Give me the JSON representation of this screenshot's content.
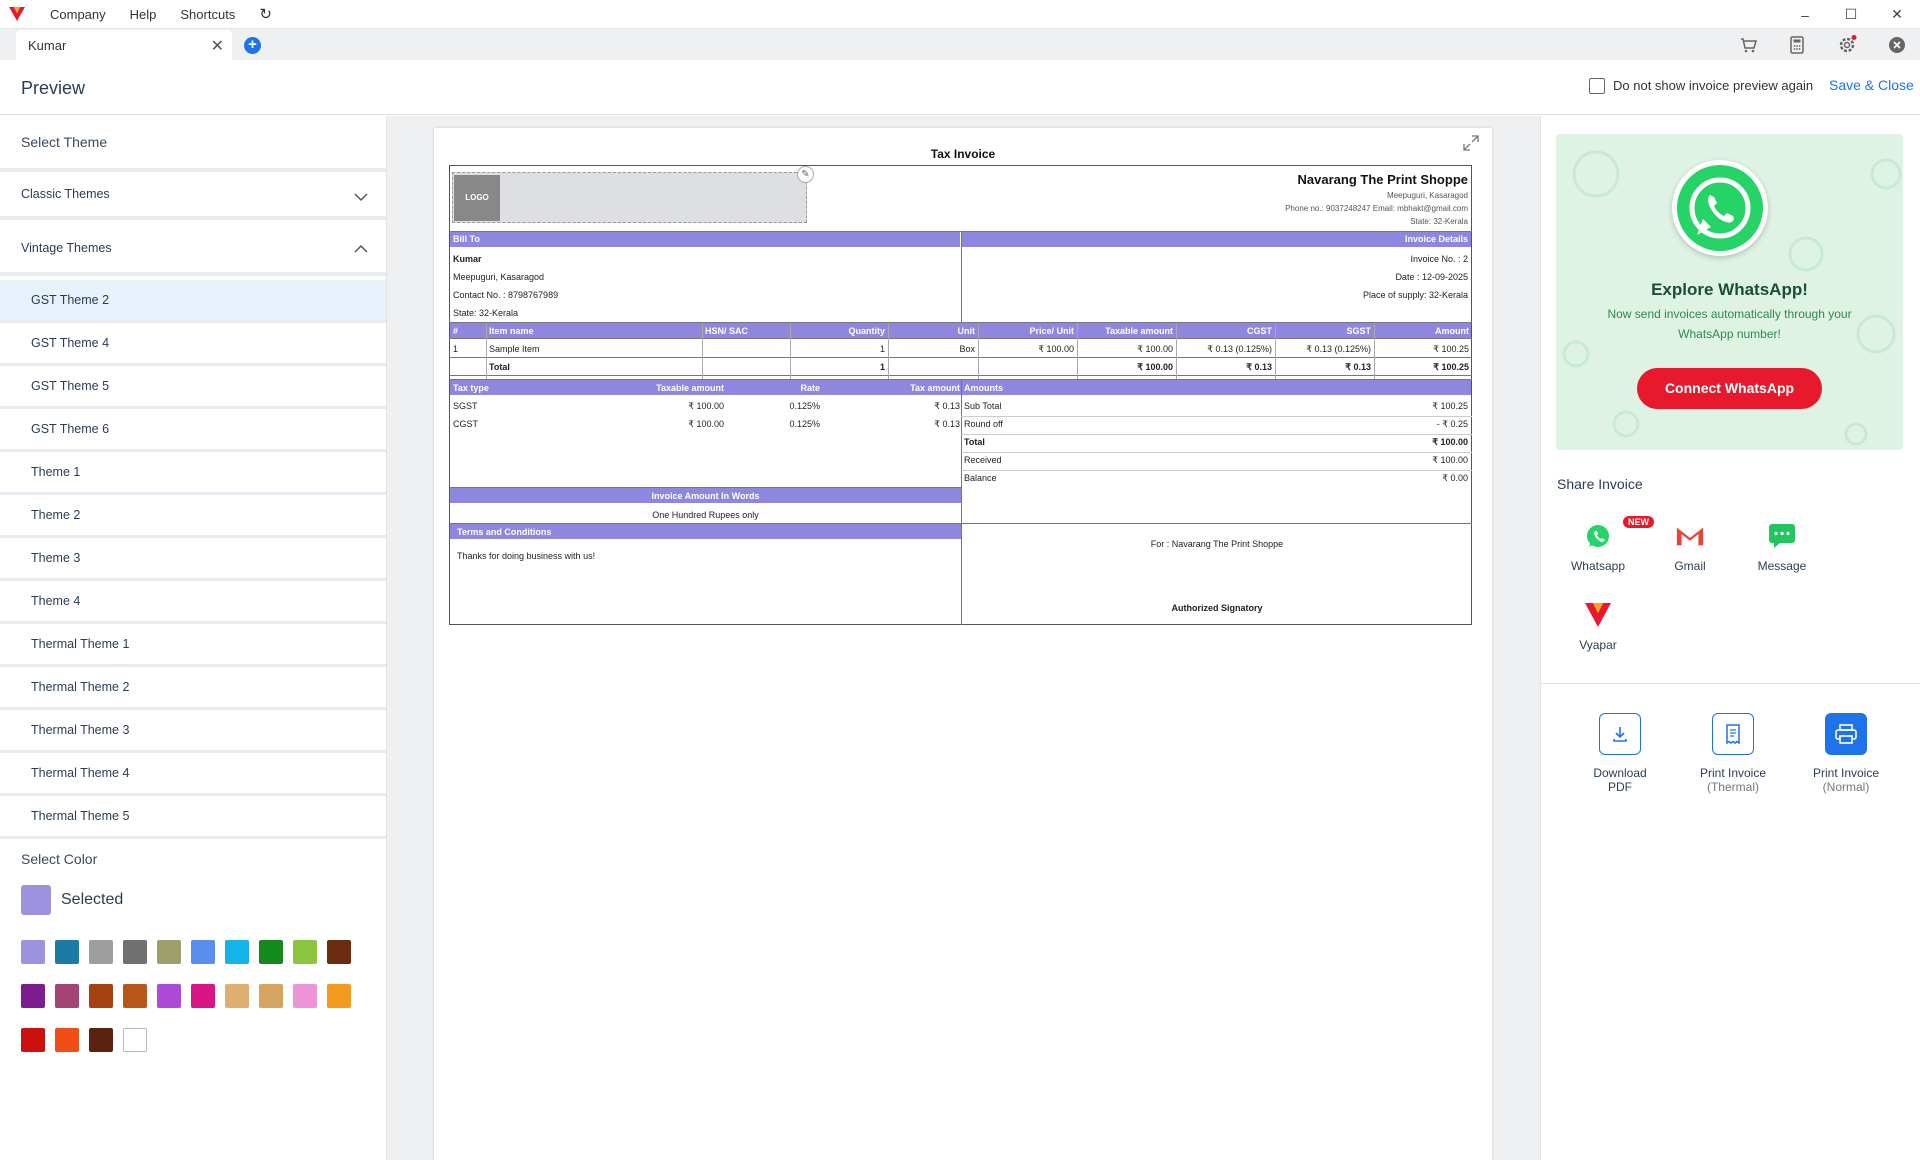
{
  "menubar": {
    "items": [
      "Company",
      "Help",
      "Shortcuts"
    ]
  },
  "tabs": [
    {
      "label": "Kumar"
    }
  ],
  "header": {
    "title": "Preview",
    "checkbox_label": "Do not show invoice preview again",
    "save_close": "Save & Close"
  },
  "left": {
    "select_theme": "Select Theme",
    "classic_themes": "Classic Themes",
    "vintage_themes": "Vintage Themes",
    "themes": [
      "GST Theme 2",
      "GST Theme 4",
      "GST Theme 5",
      "GST Theme 6",
      "Theme 1",
      "Theme 2",
      "Theme 3",
      "Theme 4",
      "Thermal Theme 1",
      "Thermal Theme 2",
      "Thermal Theme 3",
      "Thermal Theme 4",
      "Thermal Theme 5"
    ],
    "selected_theme_index": 0,
    "select_color": "Select Color",
    "selected_label": "Selected",
    "selected_color": "#9b93e0",
    "colors": [
      "#9b93e0",
      "#1b7aa6",
      "#9e9e9e",
      "#707070",
      "#9ea06c",
      "#5b8ded",
      "#16b3ea",
      "#148a1d",
      "#8cc63f",
      "#6b2b0e",
      "#7d1c8f",
      "#a34371",
      "#a5400f",
      "#b85719",
      "#ae49d9",
      "#d91484",
      "#e0ae6e",
      "#d6a45e",
      "#ef94d9",
      "#f39a1e",
      "#cc1010",
      "#ef4e17",
      "#5c2210",
      "#ffffff"
    ]
  },
  "invoice": {
    "title": "Tax Invoice",
    "logo_text": "LOGO",
    "company": {
      "name": "Navarang The Print Shoppe",
      "address": "Meepuguri, Kasaragod",
      "contact": "Phone no.: 9037248247 Email: mbhakt@gmail.com",
      "state": "State: 32-Kerala"
    },
    "bill_to_label": "Bill To",
    "invoice_details_label": "Invoice Details",
    "bill_to": {
      "name": "Kumar",
      "address": "Meepuguri, Kasaragod",
      "contact": "Contact No. : 8798767989",
      "state": "State: 32-Kerala"
    },
    "details": {
      "invoice_no": "Invoice No. : 2",
      "date": "Date : 12-09-2025",
      "place": "Place of supply: 32-Kerala"
    },
    "item_headers": [
      "#",
      "Item name",
      "HSN/ SAC",
      "Quantity",
      "Unit",
      "Price/ Unit",
      "Taxable amount",
      "CGST",
      "SGST",
      "Amount"
    ],
    "items": [
      [
        "1",
        "Sample Item",
        "",
        "1",
        "Box",
        "₹ 100.00",
        "₹ 100.00",
        "₹ 0.13 (0.125%)",
        "₹ 0.13 (0.125%)",
        "₹ 100.25"
      ]
    ],
    "total_row": [
      "",
      "Total",
      "",
      "1",
      "",
      "",
      "₹ 100.00",
      "₹ 0.13",
      "₹ 0.13",
      "₹ 100.25"
    ],
    "tax_headers": [
      "Tax type",
      "Taxable amount",
      "Rate",
      "Tax amount"
    ],
    "tax_rows": [
      [
        "SGST",
        "₹ 100.00",
        "0.125%",
        "₹ 0.13"
      ],
      [
        "CGST",
        "₹ 100.00",
        "0.125%",
        "₹ 0.13"
      ]
    ],
    "amounts_label": "Amounts",
    "amounts": [
      [
        "Sub Total",
        "₹ 100.25"
      ],
      [
        "Round off",
        "- ₹ 0.25"
      ],
      [
        "Total",
        "₹ 100.00"
      ],
      [
        "Received",
        "₹ 100.00"
      ],
      [
        "Balance",
        "₹ 0.00"
      ]
    ],
    "amount_words_label": "Invoice Amount In Words",
    "amount_words": "One Hundred Rupees only",
    "terms_label": "Terms and Conditions",
    "terms": "Thanks for doing business with us!",
    "for_label": "For : Navarang The Print Shoppe",
    "signatory": "Authorized Signatory"
  },
  "whatsapp": {
    "title": "Explore WhatsApp!",
    "subtitle": "Now send invoices automatically through your WhatsApp number!",
    "connect": "Connect WhatsApp"
  },
  "share": {
    "title": "Share Invoice",
    "items": [
      "Whatsapp",
      "Gmail",
      "Message",
      "Vyapar"
    ],
    "new_badge": "NEW"
  },
  "actions": [
    {
      "label": "Download",
      "sub": "PDF"
    },
    {
      "label": "Print Invoice",
      "sub": "(Thermal)"
    },
    {
      "label": "Print Invoice",
      "sub": "(Normal)"
    }
  ]
}
